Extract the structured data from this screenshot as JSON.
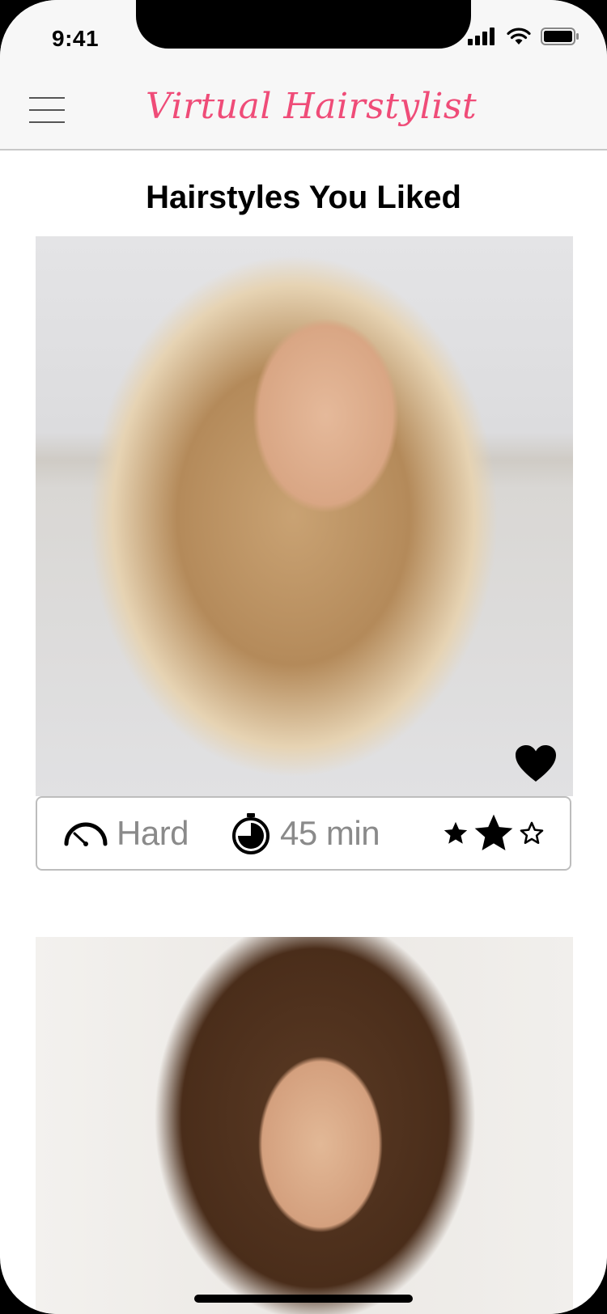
{
  "status_bar": {
    "time": "9:41"
  },
  "header": {
    "title": "Virtual Hairstylist",
    "title_color": "#ef4c78"
  },
  "page": {
    "title": "Hairstyles You Liked"
  },
  "cards": [
    {
      "photo": "hairstyle-photo-long-blonde-waves",
      "liked": true,
      "difficulty": "Hard",
      "duration": "45 min",
      "rating_level": 2,
      "rating_max": 3
    },
    {
      "photo": "hairstyle-photo-brunette-updo",
      "liked": null
    }
  ],
  "icons": {
    "menu": "hamburger-menu-icon",
    "heart": "heart-icon",
    "difficulty": "speedometer-icon",
    "duration": "stopwatch-icon",
    "rating": "star-icon"
  }
}
